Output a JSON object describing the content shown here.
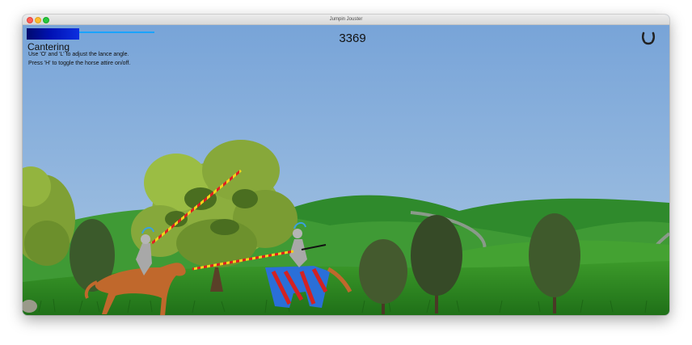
{
  "window": {
    "title": "Jumpin Jouster"
  },
  "hud": {
    "gait": "Cantering",
    "hints": [
      "Use 'O' and 'L' to adjust the lance angle.",
      "Press 'H' to toggle the horse attire on/off."
    ],
    "score": "3369",
    "speed_level": 0.41,
    "icon": "horseshoe-icon"
  },
  "colors": {
    "sky": "#7fa9d8",
    "hills": "#3f9a35",
    "grass": "#2f8a24",
    "speed_bar": "#0011b3",
    "speed_track": "#1aa3ff",
    "lance_stripe_red": "#e02020",
    "lance_stripe_yellow": "#f5d21a",
    "caparison_red": "#d32222",
    "caparison_blue": "#2a6fd8",
    "horse": "#c0682c"
  }
}
